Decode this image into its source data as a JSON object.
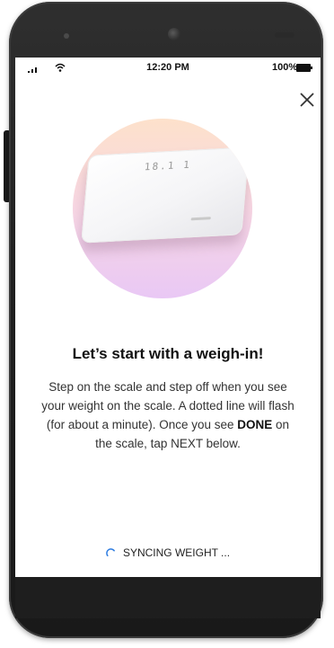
{
  "status_bar": {
    "time": "12:20 PM",
    "battery_percent": "100%",
    "signal_icon": "cellular-signal-icon",
    "wifi_icon": "wifi-icon",
    "battery_icon": "battery-icon"
  },
  "close_icon": "close-icon",
  "scale_display": "18.1 1",
  "headline": "Let’s start with a weigh-in!",
  "body": {
    "part1": "Step on the scale and step off when you see your weight on the scale. A dotted line will flash (for about a minute). Once you see ",
    "emphasis": "DONE",
    "part2": " on the scale, tap NEXT below."
  },
  "sync": {
    "label": "SYNCING WEIGHT ...",
    "icon": "spinner-icon",
    "accent": "#2f7de1"
  }
}
